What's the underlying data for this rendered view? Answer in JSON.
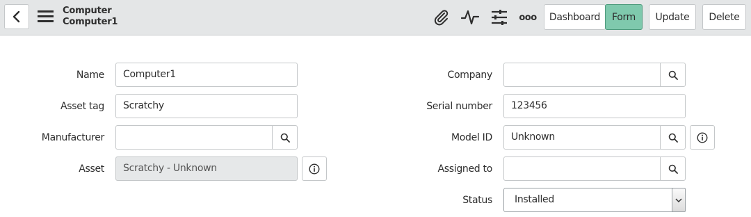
{
  "header": {
    "title": "Computer",
    "subtitle": "Computer1",
    "icons": [
      "chevron-left-icon",
      "hamburger-menu-icon",
      "paperclip-icon",
      "activity-icon",
      "sliders-icon",
      "more-icon"
    ],
    "more_label": "ooo",
    "buttons": {
      "dashboard": "Dashboard",
      "form": "Form",
      "update": "Update",
      "delete": "Delete"
    },
    "active_view": "Form",
    "accent_color": "#7fc9ad"
  },
  "form": {
    "left": {
      "name": {
        "label": "Name",
        "value": "Computer1"
      },
      "asset_tag": {
        "label": "Asset tag",
        "value": "Scratchy"
      },
      "manufacturer": {
        "label": "Manufacturer",
        "value": ""
      },
      "asset": {
        "label": "Asset",
        "value": "Scratchy - Unknown"
      }
    },
    "right": {
      "company": {
        "label": "Company",
        "value": ""
      },
      "serial_number": {
        "label": "Serial number",
        "value": "123456"
      },
      "model_id": {
        "label": "Model ID",
        "value": "Unknown"
      },
      "assigned_to": {
        "label": "Assigned to",
        "value": ""
      },
      "status": {
        "label": "Status",
        "value": "Installed"
      }
    }
  }
}
